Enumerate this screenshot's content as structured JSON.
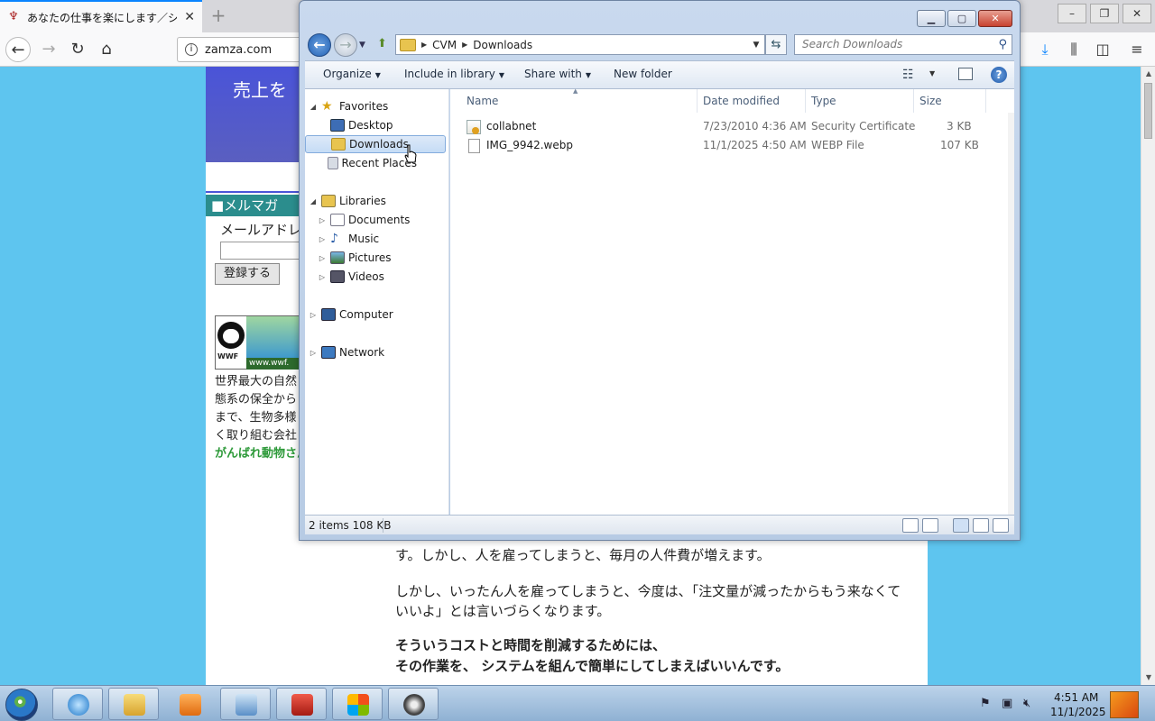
{
  "browser": {
    "tab_title": "あなたの仕事を楽にします／シ",
    "url": "zamza.com",
    "page": {
      "banner_text": "売上を",
      "merumaga_heading": "■メルマガ",
      "email_label": "メールアドレ",
      "register_button": "登録する",
      "wwf_label": "WWF",
      "wwf_url": "www.wwf.",
      "side_lines": [
        "世界最大の自然",
        "態系の保全から",
        "まで、生物多様",
        "く取り組む会社"
      ],
      "side_link": "がんばれ動物さん",
      "body_paragraph_1": "す。しかし、人を雇ってしまうと、毎月の人件費が増えます。",
      "body_paragraph_2_line1": "しかし、いったん人を雇ってしまうと、今度は、「注文量が減ったからもう来なくて",
      "body_paragraph_2_line2": "いいよ」とは言いづらくなります。",
      "bold_line_1": "そういうコストと時間を削減するためには、",
      "bold_line_2": "その作業を、 システムを組んで簡単にしてしまえばいいんです。"
    }
  },
  "explorer": {
    "breadcrumb": [
      "CVM",
      "Downloads"
    ],
    "search_placeholder": "Search Downloads",
    "commands": {
      "organize": "Organize",
      "include_in_library": "Include in library",
      "share_with": "Share with",
      "new_folder": "New folder"
    },
    "nav": {
      "favorites": "Favorites",
      "desktop": "Desktop",
      "downloads": "Downloads",
      "recent_places": "Recent Places",
      "libraries": "Libraries",
      "documents": "Documents",
      "music": "Music",
      "pictures": "Pictures",
      "videos": "Videos",
      "computer": "Computer",
      "network": "Network"
    },
    "columns": {
      "name": "Name",
      "date_modified": "Date modified",
      "type": "Type",
      "size": "Size"
    },
    "files": [
      {
        "name": "collabnet",
        "date": "7/23/2010 4:36 AM",
        "type": "Security Certificate",
        "size": "3 KB"
      },
      {
        "name": "IMG_9942.webp",
        "date": "11/1/2025 4:50 AM",
        "type": "WEBP File",
        "size": "107 KB"
      }
    ],
    "status": "2 items  108 KB"
  },
  "taskbar": {
    "time": "4:51 AM",
    "date": "11/1/2025"
  },
  "colors": {
    "page_background": "#5ec5ef",
    "explorer_frame": "#c9d9ee",
    "selection": "#c5dcf6",
    "taskbar": "#a6c2e0"
  }
}
